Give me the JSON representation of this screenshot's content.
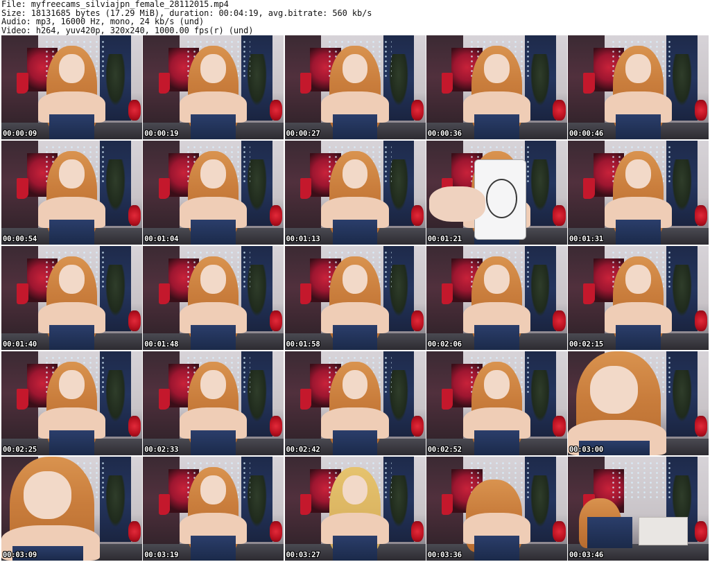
{
  "header": {
    "file_line": "File: myfreecams_silviajpn_female_28112015.mp4",
    "size_line": "Size: 18131685 bytes (17.29 MiB), duration: 00:04:19, avg.bitrate: 560 kb/s",
    "audio_line": "Audio: mp3, 16000 Hz, mono, 24 kb/s (und)",
    "video_line": "Video: h264, yuv420p, 320x240, 1000.00 fps(r) (und)"
  },
  "thumbnails": [
    {
      "time": "00:00:09",
      "variant": "normal"
    },
    {
      "time": "00:00:19",
      "variant": "normal"
    },
    {
      "time": "00:00:27",
      "variant": "normal"
    },
    {
      "time": "00:00:36",
      "variant": "normal"
    },
    {
      "time": "00:00:46",
      "variant": "normal"
    },
    {
      "time": "00:00:54",
      "variant": "normal"
    },
    {
      "time": "00:01:04",
      "variant": "normal"
    },
    {
      "time": "00:01:13",
      "variant": "normal"
    },
    {
      "time": "00:01:21",
      "variant": "card"
    },
    {
      "time": "00:01:31",
      "variant": "normal"
    },
    {
      "time": "00:01:40",
      "variant": "normal"
    },
    {
      "time": "00:01:48",
      "variant": "normal"
    },
    {
      "time": "00:01:58",
      "variant": "normal"
    },
    {
      "time": "00:02:06",
      "variant": "normal"
    },
    {
      "time": "00:02:15",
      "variant": "normal"
    },
    {
      "time": "00:02:25",
      "variant": "normal"
    },
    {
      "time": "00:02:33",
      "variant": "normal"
    },
    {
      "time": "00:02:42",
      "variant": "normal"
    },
    {
      "time": "00:02:52",
      "variant": "normal"
    },
    {
      "time": "00:03:00",
      "variant": "close"
    },
    {
      "time": "00:03:09",
      "variant": "close"
    },
    {
      "time": "00:03:19",
      "variant": "normal"
    },
    {
      "time": "00:03:27",
      "variant": "blonde"
    },
    {
      "time": "00:03:36",
      "variant": "away"
    },
    {
      "time": "00:03:46",
      "variant": "empty"
    }
  ]
}
